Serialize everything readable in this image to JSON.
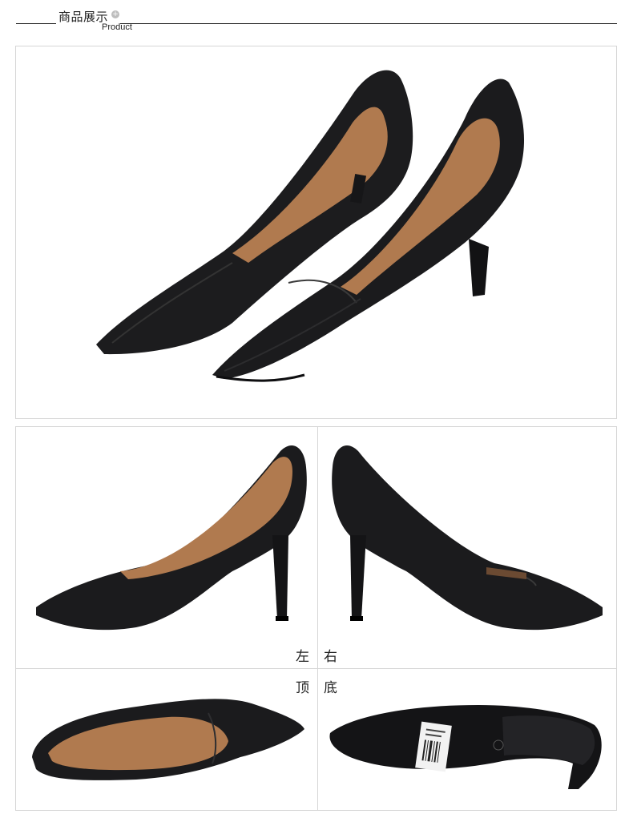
{
  "header": {
    "title": "商品展示",
    "subtitle": "Product",
    "icon": "plus-circle-icon"
  },
  "views": {
    "left_label": "左",
    "right_label": "右",
    "top_label": "顶",
    "bottom_label": "底"
  },
  "colors": {
    "leather": "#1b1b1d",
    "lining": "#b07a4f",
    "border": "#d6d6d6"
  }
}
